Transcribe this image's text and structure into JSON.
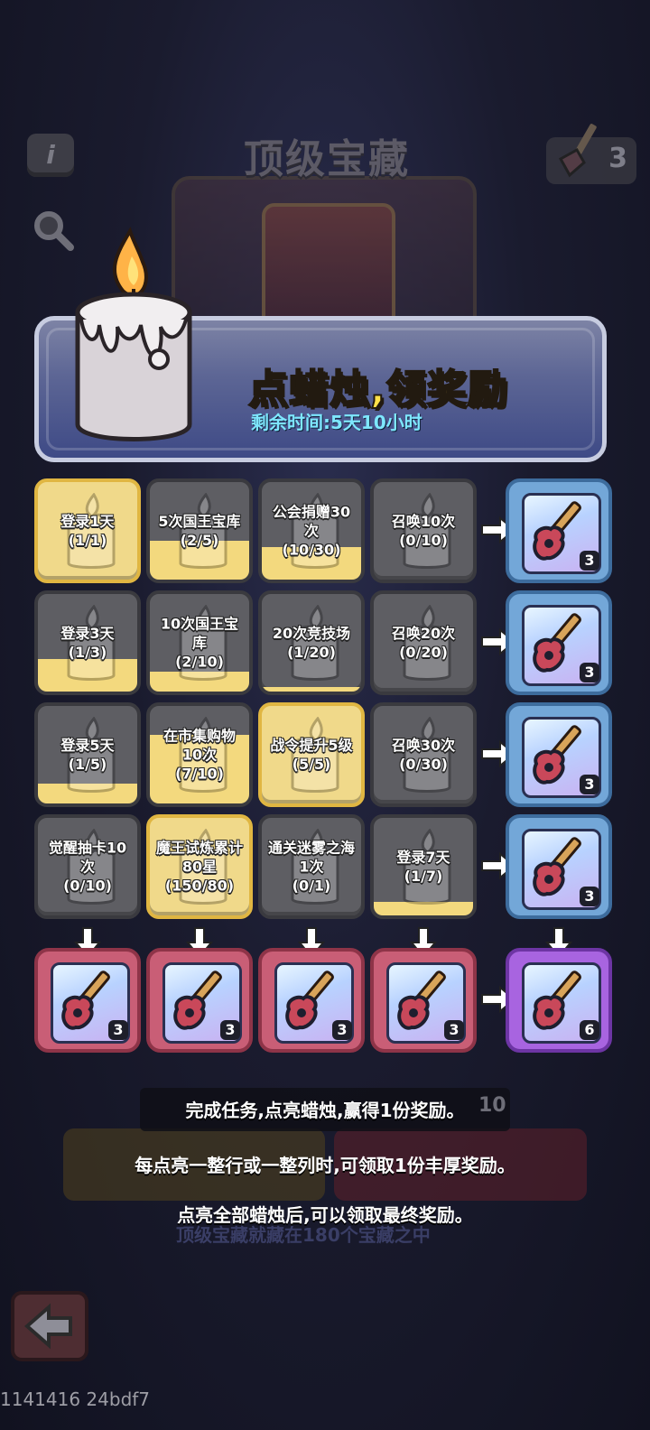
{
  "header": {
    "title": "顶级宝藏",
    "info_icon": "info-icon",
    "search_icon": "magnifier-icon",
    "currency_count": "3"
  },
  "banner": {
    "title": "点蜡烛,领奖励",
    "time_remaining": "剩余时间:5天10小时"
  },
  "grid": {
    "rows": [
      {
        "cells": [
          {
            "label": "登录1天\n(1/1)",
            "progress": 1.0
          },
          {
            "label": "5次国王宝库\n(2/5)",
            "progress": 0.4
          },
          {
            "label": "公会捐赠30\n次\n(10/30)",
            "progress": 0.33
          },
          {
            "label": "召唤10次\n(0/10)",
            "progress": 0
          }
        ],
        "reward_qty": "3"
      },
      {
        "cells": [
          {
            "label": "登录3天\n(1/3)",
            "progress": 0.33
          },
          {
            "label": "10次国王宝\n库\n(2/10)",
            "progress": 0.2
          },
          {
            "label": "20次竞技场\n(1/20)",
            "progress": 0.05
          },
          {
            "label": "召唤20次\n(0/20)",
            "progress": 0
          }
        ],
        "reward_qty": "3"
      },
      {
        "cells": [
          {
            "label": "登录5天\n(1/5)",
            "progress": 0.2
          },
          {
            "label": "在市集购物\n10次\n(7/10)",
            "progress": 0.7
          },
          {
            "label": "战令提升5级\n(5/5)",
            "progress": 1.0
          },
          {
            "label": "召唤30次\n(0/30)",
            "progress": 0
          }
        ],
        "reward_qty": "3"
      },
      {
        "cells": [
          {
            "label": "觉醒抽卡10\n次\n(0/10)",
            "progress": 0
          },
          {
            "label": "魔王试炼累计\n80星\n(150/80)",
            "progress": 1.0
          },
          {
            "label": "通关迷雾之海\n1次\n(0/1)",
            "progress": 0
          },
          {
            "label": "登录7天\n(1/7)",
            "progress": 0.14
          }
        ],
        "reward_qty": "3"
      }
    ],
    "column_reward_qty": [
      "3",
      "3",
      "3",
      "3"
    ],
    "final_reward_qty": "6"
  },
  "tips": {
    "line1": "完成任务,点亮蜡烛,赢得1份奖励。",
    "line2": "每点亮一整行或一整列时,可领取1份丰厚奖励。",
    "line3": "点亮全部蜡烛后,可以领取最终奖励。"
  },
  "background_text": {
    "subtitle": "顶级宝藏就藏在180个宝藏之中",
    "counter": "10"
  },
  "footer": {
    "build": "1141416 24bdf7"
  },
  "colors": {
    "lit": "#f0d98a",
    "unlit": "#5e5e63",
    "reward_blue": "#73a7d8",
    "reward_pink": "#c95e76",
    "reward_purple": "#a864e0",
    "title_yellow": "#ffe14a",
    "time_cyan": "#7ee7ff"
  }
}
